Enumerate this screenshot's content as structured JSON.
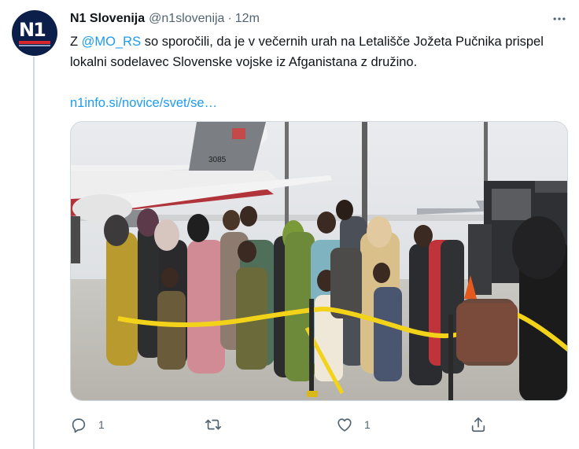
{
  "tweet": {
    "display_name": "N1 Slovenija",
    "handle": "@n1slovenija",
    "separator": "·",
    "timestamp": "12m",
    "avatar_text": "N1",
    "text_before_mention": "Z ",
    "mention": "@MO_RS",
    "text_after_mention": " so sporočili, da je v večernih urah na Letališče Jožeta Pučnika prispel lokalni sodelavec Slovenske vojske iz Afganistana z družino.",
    "link": "n1info.si/novice/svet/se…",
    "plane_tail_number": "3085"
  },
  "actions": {
    "reply_count": "1",
    "like_count": "1"
  },
  "icons": {
    "more": "more-horizontal-icon",
    "reply": "reply-icon",
    "retweet": "retweet-icon",
    "like": "heart-icon",
    "share": "share-icon"
  },
  "colors": {
    "accent": "#1d9bf0",
    "text_primary": "#0f1419",
    "text_secondary": "#536471",
    "border": "#cfd9de",
    "avatar_bg": "#0b1f4a"
  }
}
